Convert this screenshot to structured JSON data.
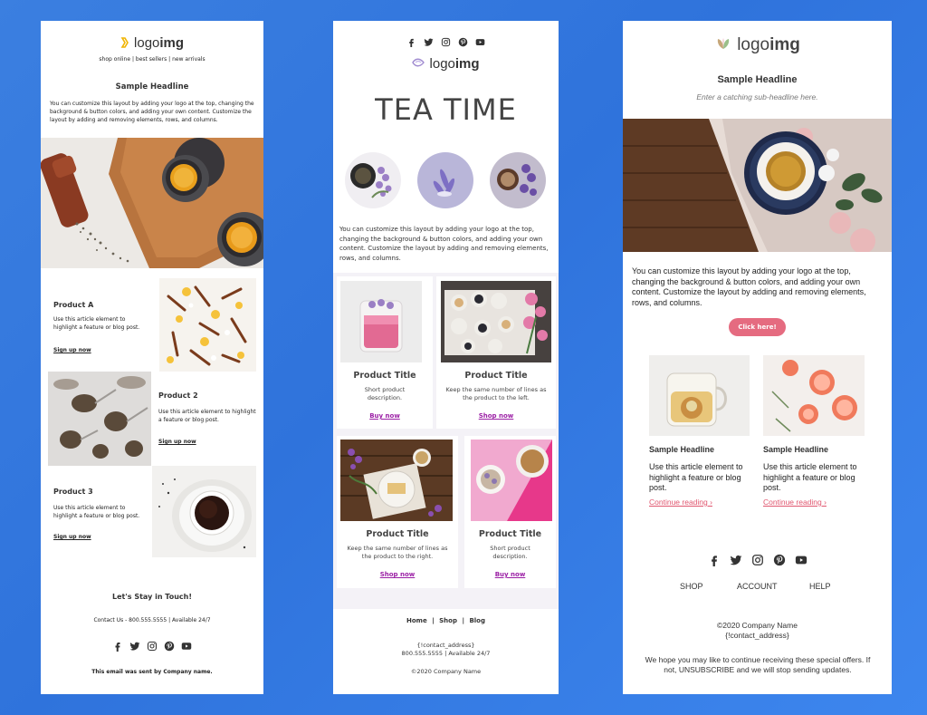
{
  "panel1": {
    "logo": {
      "text_light": "logo",
      "text_bold": "img"
    },
    "nav": [
      "shop online",
      "best sellers",
      "new arrivals"
    ],
    "nav_sep": "|",
    "headline": "Sample Headline",
    "intro": "You can customize this layout by adding your logo at the top, changing the background & button colors, and adding your own content. Customize the layout by adding and removing elements, rows, and columns.",
    "products": [
      {
        "title": "Product A",
        "desc": "Use this article element to highlight a feature or blog post.",
        "link": "Sign up now"
      },
      {
        "title": "Product 2",
        "desc": "Use this article element to highlight a feature or blog post.",
        "link": "Sign up now"
      },
      {
        "title": "Product 3",
        "desc": "Use this article element to highlight a feature or blog post.",
        "link": "Sign up now"
      }
    ],
    "stay_title": "Let's Stay in Touch!",
    "contact": "Contact Us - 800.555.5555  |  Available 24/7",
    "footer": "This email was sent by Company name.",
    "social_icons": [
      "facebook-icon",
      "twitter-icon",
      "instagram-icon",
      "pinterest-icon",
      "youtube-icon"
    ]
  },
  "panel2": {
    "social_icons": [
      "facebook-icon",
      "twitter-icon",
      "instagram-icon",
      "pinterest-icon",
      "youtube-icon"
    ],
    "logo": {
      "text_light": "logo",
      "text_bold": "img"
    },
    "title": "TEA TIME",
    "intro": "You can customize this layout by adding your logo at the top, changing the background & button colors, and adding your own content. Customize the layout by adding and removing elements, rows, and columns.",
    "products": [
      {
        "title": "Product Title",
        "desc": "Short product description.",
        "link": "Buy now"
      },
      {
        "title": "Product Title",
        "desc": "Keep the same number of lines as the product to the left.",
        "link": "Shop now"
      },
      {
        "title": "Product Title",
        "desc": "Keep the same number of lines as the product to the right.",
        "link": "Shop now"
      },
      {
        "title": "Product Title",
        "desc": "Short product description.",
        "link": "Buy now"
      }
    ],
    "footer_nav": [
      "Home",
      "Shop",
      "Blog"
    ],
    "nav_sep": "|",
    "address": "{!contact_address}",
    "contact": "800.555.5555  |  Available 24/7",
    "copyright": "©2020 Company Name"
  },
  "panel3": {
    "logo": {
      "text_light": "logo",
      "text_bold": "img"
    },
    "headline": "Sample Headline",
    "subheadline": "Enter a catching sub-headline here.",
    "intro": "You can customize this layout by adding your logo at the top, changing the background & button colors, and adding your own content. Customize the layout by adding and removing elements, rows, and columns.",
    "cta": "Click here!",
    "articles": [
      {
        "title": "Sample Headline",
        "desc": "Use this article element to highlight a feature or blog post.",
        "link": "Continue reading ›"
      },
      {
        "title": "Sample Headline",
        "desc": "Use this article element to highlight a feature or blog post.",
        "link": "Continue reading ›"
      }
    ],
    "social_icons": [
      "facebook-icon",
      "twitter-icon",
      "instagram-icon",
      "pinterest-icon",
      "youtube-icon"
    ],
    "nav": [
      "SHOP",
      "ACCOUNT",
      "HELP"
    ],
    "company": "©2020 Company Name",
    "address": "{!contact_address}",
    "unsubscribe": "We hope you may like to continue receiving these special offers. If not, UNSUBSCRIBE and we will stop sending updates."
  },
  "colors": {
    "background": "#3277e0",
    "accent_purple": "#9b1fa5",
    "accent_pink": "#e0566f",
    "logo_gold": "#f0b400"
  }
}
